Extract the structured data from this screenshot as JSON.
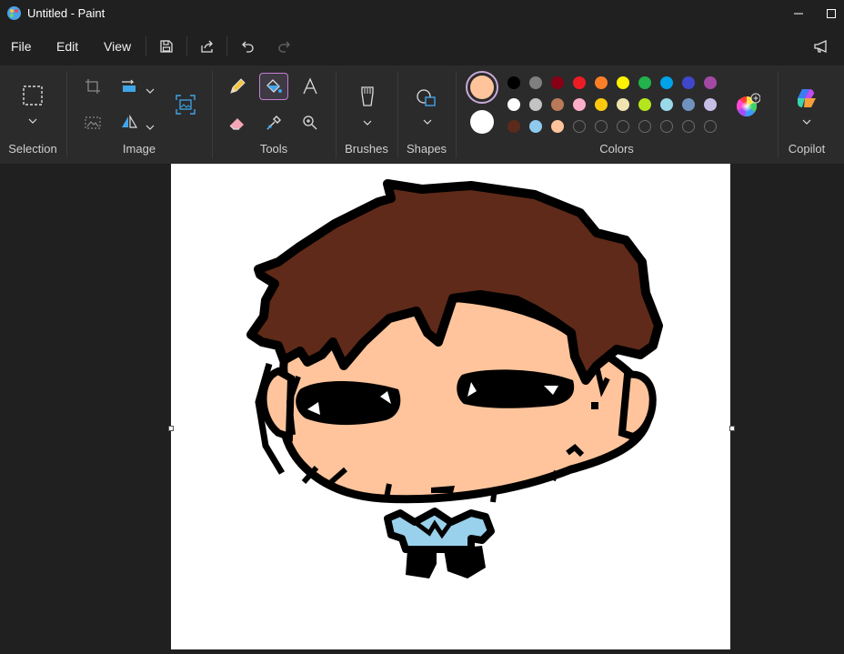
{
  "window": {
    "title": "Untitled - Paint"
  },
  "menu": {
    "file": "File",
    "edit": "Edit",
    "view": "View"
  },
  "groups": {
    "selection": "Selection",
    "image": "Image",
    "tools": "Tools",
    "brushes": "Brushes",
    "shapes": "Shapes",
    "colors": "Colors",
    "copilot": "Copilot"
  },
  "colors": {
    "primary": "#FFC49C",
    "secondary": "#FFFFFF",
    "row1": [
      "#000000",
      "#7F7F7F",
      "#880015",
      "#ED1C24",
      "#FF7F27",
      "#FFF200",
      "#22B14C",
      "#00A2E8",
      "#3F48CC",
      "#A349A4"
    ],
    "row2": [
      "#FFFFFF",
      "#C3C3C3",
      "#B97A57",
      "#FFAEC9",
      "#FFC90E",
      "#EFE4B0",
      "#B5E61D",
      "#99D9EA",
      "#7092BE",
      "#C8BFE7"
    ],
    "row3": [
      "#5C2A1A",
      "#8FC9EE",
      "#FFC49C",
      "",
      "",
      "",
      "",
      "",
      "",
      ""
    ]
  },
  "drawing": {
    "hair": "#5F2A19",
    "skin": "#FFC49C",
    "shirt": "#99D1EC",
    "outline": "#000000"
  }
}
